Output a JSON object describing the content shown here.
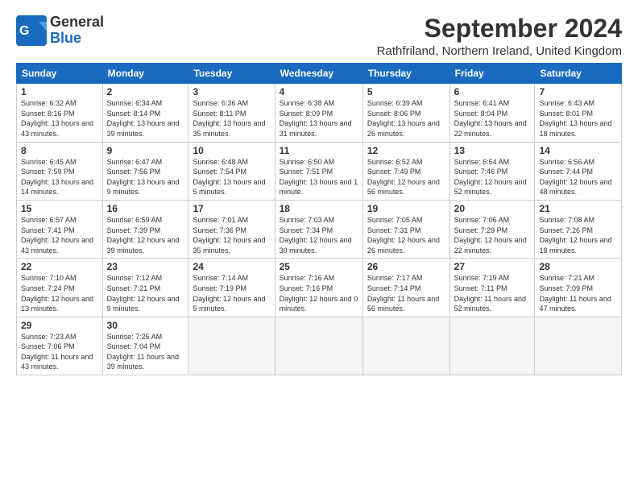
{
  "logo": {
    "line1": "General",
    "line2": "Blue"
  },
  "title": "September 2024",
  "location": "Rathfriland, Northern Ireland, United Kingdom",
  "weekdays": [
    "Sunday",
    "Monday",
    "Tuesday",
    "Wednesday",
    "Thursday",
    "Friday",
    "Saturday"
  ],
  "weeks": [
    [
      {
        "day": "1",
        "sunrise": "6:32 AM",
        "sunset": "8:16 PM",
        "daylight": "13 hours and 43 minutes."
      },
      {
        "day": "2",
        "sunrise": "6:34 AM",
        "sunset": "8:14 PM",
        "daylight": "13 hours and 39 minutes."
      },
      {
        "day": "3",
        "sunrise": "6:36 AM",
        "sunset": "8:11 PM",
        "daylight": "13 hours and 35 minutes."
      },
      {
        "day": "4",
        "sunrise": "6:38 AM",
        "sunset": "8:09 PM",
        "daylight": "13 hours and 31 minutes."
      },
      {
        "day": "5",
        "sunrise": "6:39 AM",
        "sunset": "8:06 PM",
        "daylight": "13 hours and 26 minutes."
      },
      {
        "day": "6",
        "sunrise": "6:41 AM",
        "sunset": "8:04 PM",
        "daylight": "13 hours and 22 minutes."
      },
      {
        "day": "7",
        "sunrise": "6:43 AM",
        "sunset": "8:01 PM",
        "daylight": "13 hours and 18 minutes."
      }
    ],
    [
      {
        "day": "8",
        "sunrise": "6:45 AM",
        "sunset": "7:59 PM",
        "daylight": "13 hours and 14 minutes."
      },
      {
        "day": "9",
        "sunrise": "6:47 AM",
        "sunset": "7:56 PM",
        "daylight": "13 hours and 9 minutes."
      },
      {
        "day": "10",
        "sunrise": "6:48 AM",
        "sunset": "7:54 PM",
        "daylight": "13 hours and 5 minutes."
      },
      {
        "day": "11",
        "sunrise": "6:50 AM",
        "sunset": "7:51 PM",
        "daylight": "13 hours and 1 minute."
      },
      {
        "day": "12",
        "sunrise": "6:52 AM",
        "sunset": "7:49 PM",
        "daylight": "12 hours and 56 minutes."
      },
      {
        "day": "13",
        "sunrise": "6:54 AM",
        "sunset": "7:46 PM",
        "daylight": "12 hours and 52 minutes."
      },
      {
        "day": "14",
        "sunrise": "6:56 AM",
        "sunset": "7:44 PM",
        "daylight": "12 hours and 48 minutes."
      }
    ],
    [
      {
        "day": "15",
        "sunrise": "6:57 AM",
        "sunset": "7:41 PM",
        "daylight": "12 hours and 43 minutes."
      },
      {
        "day": "16",
        "sunrise": "6:59 AM",
        "sunset": "7:39 PM",
        "daylight": "12 hours and 39 minutes."
      },
      {
        "day": "17",
        "sunrise": "7:01 AM",
        "sunset": "7:36 PM",
        "daylight": "12 hours and 35 minutes."
      },
      {
        "day": "18",
        "sunrise": "7:03 AM",
        "sunset": "7:34 PM",
        "daylight": "12 hours and 30 minutes."
      },
      {
        "day": "19",
        "sunrise": "7:05 AM",
        "sunset": "7:31 PM",
        "daylight": "12 hours and 26 minutes."
      },
      {
        "day": "20",
        "sunrise": "7:06 AM",
        "sunset": "7:29 PM",
        "daylight": "12 hours and 22 minutes."
      },
      {
        "day": "21",
        "sunrise": "7:08 AM",
        "sunset": "7:26 PM",
        "daylight": "12 hours and 18 minutes."
      }
    ],
    [
      {
        "day": "22",
        "sunrise": "7:10 AM",
        "sunset": "7:24 PM",
        "daylight": "12 hours and 13 minutes."
      },
      {
        "day": "23",
        "sunrise": "7:12 AM",
        "sunset": "7:21 PM",
        "daylight": "12 hours and 9 minutes."
      },
      {
        "day": "24",
        "sunrise": "7:14 AM",
        "sunset": "7:19 PM",
        "daylight": "12 hours and 5 minutes."
      },
      {
        "day": "25",
        "sunrise": "7:16 AM",
        "sunset": "7:16 PM",
        "daylight": "12 hours and 0 minutes."
      },
      {
        "day": "26",
        "sunrise": "7:17 AM",
        "sunset": "7:14 PM",
        "daylight": "11 hours and 56 minutes."
      },
      {
        "day": "27",
        "sunrise": "7:19 AM",
        "sunset": "7:11 PM",
        "daylight": "11 hours and 52 minutes."
      },
      {
        "day": "28",
        "sunrise": "7:21 AM",
        "sunset": "7:09 PM",
        "daylight": "11 hours and 47 minutes."
      }
    ],
    [
      {
        "day": "29",
        "sunrise": "7:23 AM",
        "sunset": "7:06 PM",
        "daylight": "11 hours and 43 minutes."
      },
      {
        "day": "30",
        "sunrise": "7:25 AM",
        "sunset": "7:04 PM",
        "daylight": "11 hours and 39 minutes."
      },
      null,
      null,
      null,
      null,
      null
    ]
  ]
}
